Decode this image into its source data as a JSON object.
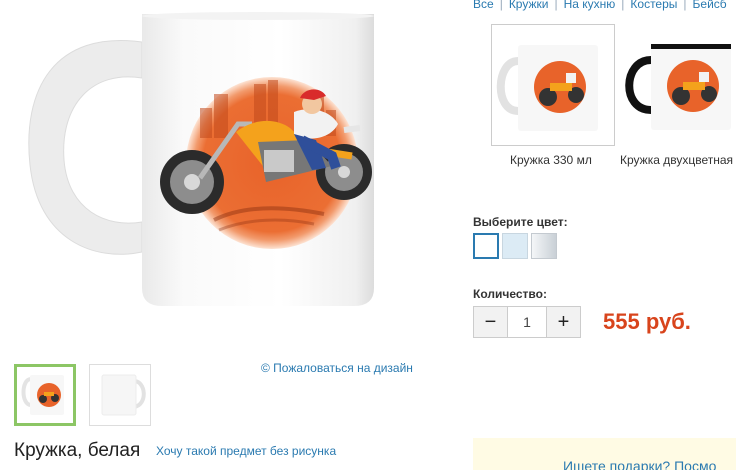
{
  "category_nav": {
    "items": [
      "Все",
      "Кружки",
      "На кухню",
      "Костеры",
      "Бейсб"
    ]
  },
  "product": {
    "title": "Кружка, белая",
    "no_print_link": "Хочу такой предмет без рисунка",
    "complain_link": "© Пожаловаться на дизайн"
  },
  "variants": [
    {
      "label": "Кружка 330 мл",
      "selected": true
    },
    {
      "label": "Кружка двухцветная",
      "selected": false
    }
  ],
  "color": {
    "label": "Выберите цвет:",
    "swatches": [
      {
        "name": "white",
        "color": "#ffffff",
        "selected": true
      },
      {
        "name": "light-blue",
        "color": "#dcebf5",
        "selected": false
      },
      {
        "name": "silver",
        "color": "#d6dde3",
        "selected": false
      }
    ]
  },
  "quantity": {
    "label": "Количество:",
    "value": "1",
    "minus": "−",
    "plus": "+"
  },
  "price": "555 руб.",
  "promo": {
    "text": "Ищете подарки? Посмо"
  },
  "colors": {
    "link": "#2a7ab0",
    "price": "#d8441c",
    "thumb_active_border": "#8cc665",
    "design_orange": "#e8632a"
  }
}
